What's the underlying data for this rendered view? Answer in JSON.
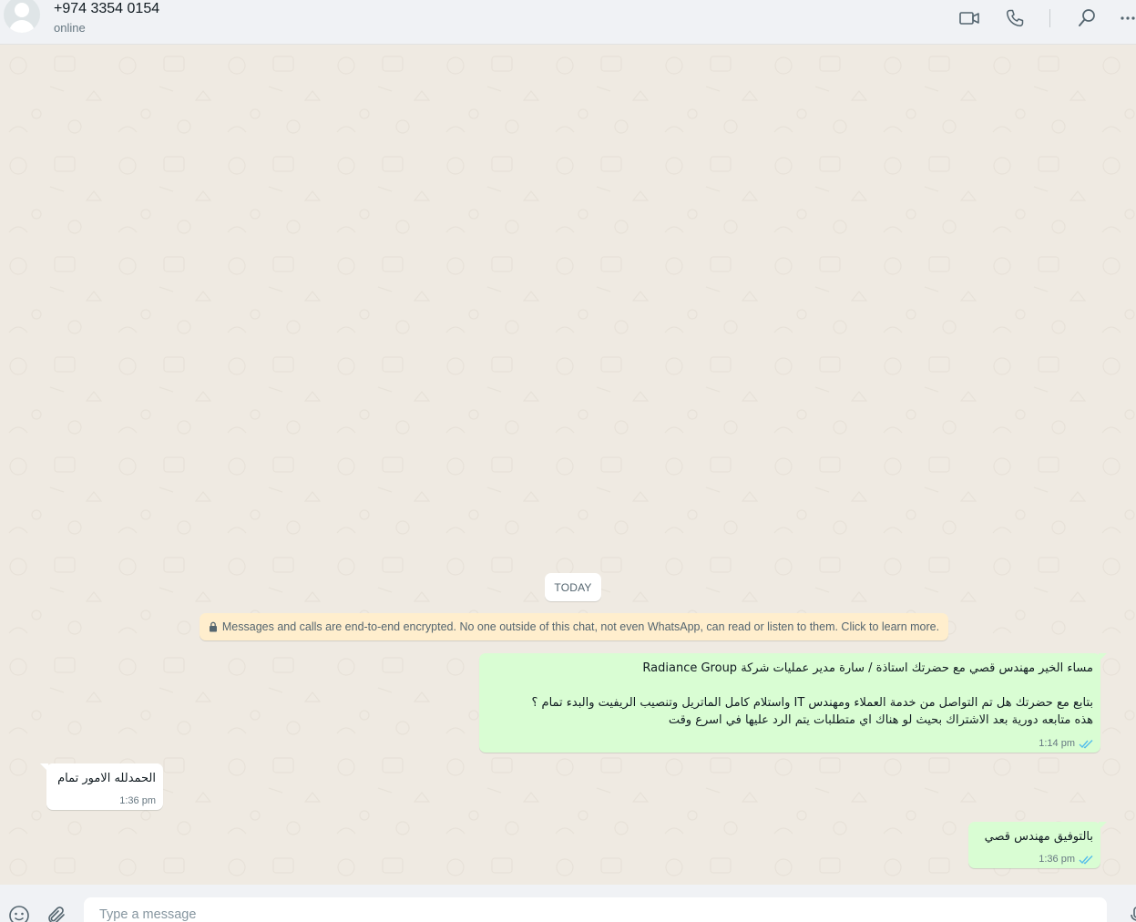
{
  "header": {
    "contact_name": "+974 3354 0154",
    "status": "online",
    "icons": [
      "video-call-icon",
      "voice-call-icon",
      "search-icon",
      "menu-icon"
    ]
  },
  "chat": {
    "date_label": "TODAY",
    "encryption_notice": "Messages and calls are end-to-end encrypted. No one outside of this chat, not even WhatsApp, can read or listen to them. Click to learn more.",
    "messages": [
      {
        "direction": "outgoing",
        "text": "مساء الخير مهندس قصي مع حضرتك استاذة / سارة مدير عمليات شركة Radiance Group\n\nبتابع مع حضرتك هل تم التواصل من خدمة العملاء ومهندس IT واستلام كامل الماتريل وتنصيب الريفيت والبدء تمام ؟\nهذه متابعه دورية بعد الاشتراك بحيث لو هناك اي متطلبات يتم الرد عليها في اسرع وقت",
        "time": "1:14 pm",
        "status": "read"
      },
      {
        "direction": "incoming",
        "text": "الحمدلله الامور تمام",
        "time": "1:36 pm"
      },
      {
        "direction": "outgoing",
        "text": "بالتوفيق مهندس قصي",
        "time": "1:36 pm",
        "status": "read"
      }
    ]
  },
  "composer": {
    "placeholder": "Type a message",
    "icons": [
      "emoji-icon",
      "attach-icon",
      "mic-icon"
    ]
  },
  "colors": {
    "outgoing_bubble": "#d9fdd3",
    "incoming_bubble": "#ffffff",
    "chat_background": "#efeae2",
    "read_tick": "#53bdeb",
    "system_notice": "#ffeecd"
  }
}
